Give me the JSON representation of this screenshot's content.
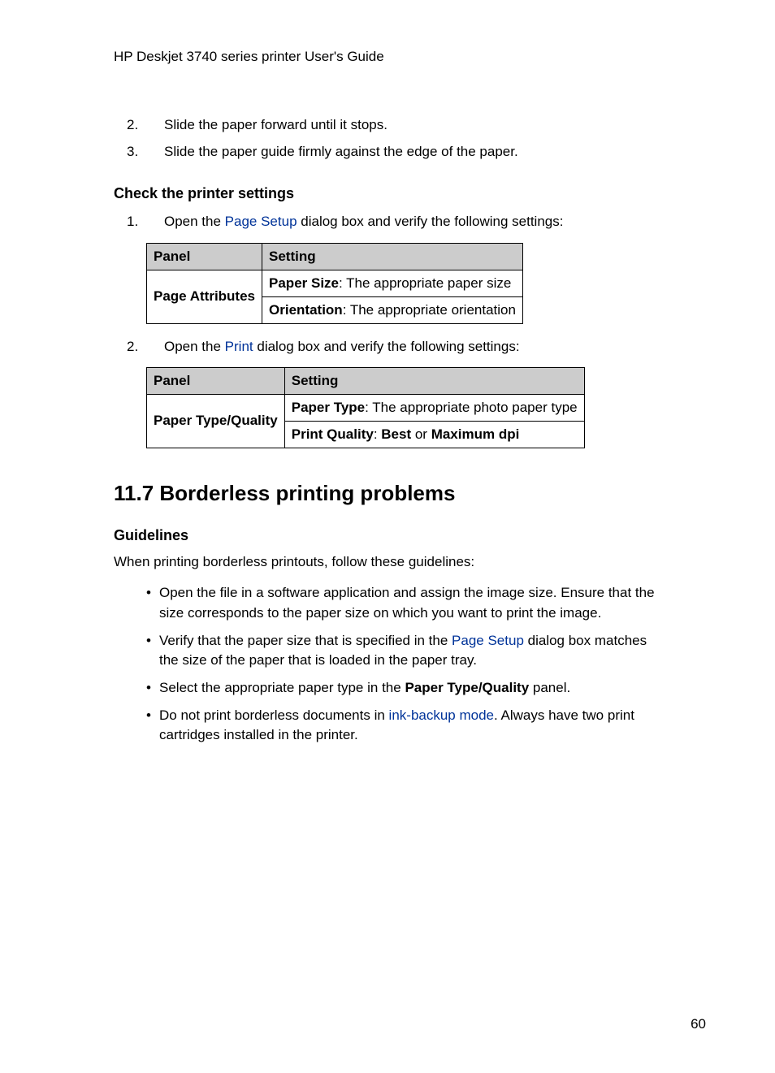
{
  "header": {
    "title": "HP Deskjet 3740 series printer User's Guide"
  },
  "steps_top": [
    {
      "num": "2.",
      "text": "Slide the paper forward until it stops."
    },
    {
      "num": "3.",
      "text": "Slide the paper guide firmly against the edge of the paper."
    }
  ],
  "check_settings": {
    "heading": "Check the printer settings",
    "step1": {
      "num": "1.",
      "pre": "Open the ",
      "link": "Page Setup",
      "post": " dialog box and verify the following settings:"
    },
    "step2": {
      "num": "2.",
      "pre": "Open the ",
      "link": "Print",
      "post": " dialog box and verify the following settings:"
    }
  },
  "table1": {
    "headers": {
      "panel": "Panel",
      "setting": "Setting"
    },
    "panel": "Page Attributes",
    "rows": [
      {
        "bold": "Paper Size",
        "text": ": The appropriate paper size"
      },
      {
        "bold": "Orientation",
        "text": ": The appropriate orientation"
      }
    ]
  },
  "table2": {
    "headers": {
      "panel": "Panel",
      "setting": "Setting"
    },
    "panel": "Paper Type/Quality",
    "rows": [
      {
        "bold": "Paper Type",
        "text": ": The appropriate photo paper type"
      },
      {
        "bold": "Print Quality",
        "mid": ": ",
        "bold2": "Best",
        "mid2": " or ",
        "bold3": "Maximum dpi"
      }
    ]
  },
  "section": {
    "title": "11.7  Borderless printing problems",
    "guidelines_heading": "Guidelines",
    "intro": "When printing borderless printouts, follow these guidelines:"
  },
  "bullets": [
    {
      "text": "Open the file in a software application and assign the image size. Ensure that the size corresponds to the paper size on which you want to print the image."
    },
    {
      "pre": "Verify that the paper size that is specified in the ",
      "link": "Page Setup",
      "post": " dialog box matches the size of the paper that is loaded in the paper tray."
    },
    {
      "pre": "Select the appropriate paper type in the ",
      "bold": "Paper Type/Quality",
      "post": " panel."
    },
    {
      "pre": "Do not print borderless documents in ",
      "link": "ink-backup mode",
      "post": ". Always have two print cartridges installed in the printer."
    }
  ],
  "page_number": "60"
}
